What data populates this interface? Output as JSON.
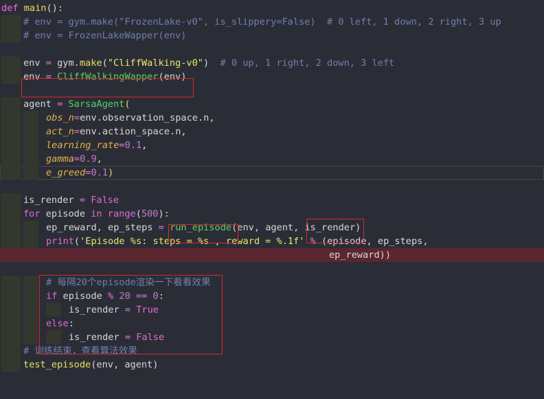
{
  "lines": [
    [
      [
        "def",
        "def"
      ],
      [
        " ",
        "id"
      ],
      [
        "main",
        "fn"
      ],
      [
        "():",
        "id"
      ]
    ],
    [
      [
        "# env = gym.make(\"FrozenLake-v0\", is_slippery=False)  # 0 left, 1 down, 2 right, 3 up",
        "cm"
      ]
    ],
    [
      [
        "# env = FrozenLakeWapper(env)",
        "cm"
      ]
    ],
    [],
    [
      [
        "env",
        "id"
      ],
      [
        " = ",
        "op"
      ],
      [
        "gym.",
        "id"
      ],
      [
        "make",
        "fn"
      ],
      [
        "(",
        "id"
      ],
      [
        "\"CliffWalking-v0\"",
        "str"
      ],
      [
        ")  ",
        "id"
      ],
      [
        "# 0 up, 1 right, 2 down, 3 left",
        "cm"
      ]
    ],
    [
      [
        "env",
        "id"
      ],
      [
        " = ",
        "op"
      ],
      [
        "CliffWalkingWapper",
        "cls"
      ],
      [
        "(env)",
        "id"
      ]
    ],
    [],
    [
      [
        "agent",
        "id"
      ],
      [
        " = ",
        "op"
      ],
      [
        "SarsaAgent",
        "cls"
      ],
      [
        "(",
        "fn"
      ]
    ],
    [
      [
        "obs_n",
        "param"
      ],
      [
        "=",
        "op"
      ],
      [
        "env.observation_space.n,",
        "id"
      ]
    ],
    [
      [
        "act_n",
        "param"
      ],
      [
        "=",
        "op"
      ],
      [
        "env.action_space.n,",
        "id"
      ]
    ],
    [
      [
        "learning_rate",
        "param"
      ],
      [
        "=",
        "op"
      ],
      [
        "0.1",
        "num"
      ],
      [
        ",",
        "id"
      ]
    ],
    [
      [
        "gamma",
        "param"
      ],
      [
        "=",
        "op"
      ],
      [
        "0.9",
        "num"
      ],
      [
        ",",
        "id"
      ]
    ],
    [
      [
        "e_greed",
        "param"
      ],
      [
        "=",
        "op"
      ],
      [
        "0.1",
        "num"
      ],
      [
        ")",
        "fn"
      ]
    ],
    [],
    [
      [
        "is_render",
        "id"
      ],
      [
        " = ",
        "op"
      ],
      [
        "False",
        "kwc"
      ]
    ],
    [
      [
        "for",
        "kwc"
      ],
      [
        " episode ",
        "id"
      ],
      [
        "in",
        "kwc"
      ],
      [
        " ",
        "id"
      ],
      [
        "range",
        "builtin"
      ],
      [
        "(",
        "id"
      ],
      [
        "500",
        "num"
      ],
      [
        "):",
        "id"
      ]
    ],
    [
      [
        "ep_reward, ep_steps",
        "id"
      ],
      [
        " = ",
        "op"
      ],
      [
        "run_episode",
        "cls"
      ],
      [
        "(env, agent, is_render)",
        "id"
      ]
    ],
    [
      [
        "print",
        "builtin"
      ],
      [
        "(",
        "id"
      ],
      [
        "'Episode %s: steps = %s , reward = %.1f'",
        "str"
      ],
      [
        " ",
        "id"
      ],
      [
        "%",
        "op"
      ],
      [
        " (episode, ep_steps,",
        "id"
      ]
    ],
    [
      [
        "ep_reward))",
        "id"
      ]
    ],
    [],
    [
      [
        "# 每隔20个episode渲染一下看看效果",
        "cm"
      ]
    ],
    [
      [
        "if",
        "kwc"
      ],
      [
        " episode ",
        "id"
      ],
      [
        "%",
        "op"
      ],
      [
        " ",
        "id"
      ],
      [
        "20",
        "num"
      ],
      [
        " ",
        "id"
      ],
      [
        "==",
        "op"
      ],
      [
        " ",
        "id"
      ],
      [
        "0",
        "num"
      ],
      [
        ":",
        "id"
      ]
    ],
    [
      [
        "is_render",
        "id"
      ],
      [
        " = ",
        "op"
      ],
      [
        "True",
        "kwc"
      ]
    ],
    [
      [
        "else",
        "kwc"
      ],
      [
        ":",
        "id"
      ]
    ],
    [
      [
        "is_render",
        "id"
      ],
      [
        " = ",
        "op"
      ],
      [
        "False",
        "kwc"
      ]
    ],
    [
      [
        "# 训练结束，查看算法效果",
        "cm"
      ]
    ],
    [
      [
        "test_episode",
        "fn"
      ],
      [
        "(env, agent)",
        "id"
      ]
    ]
  ]
}
